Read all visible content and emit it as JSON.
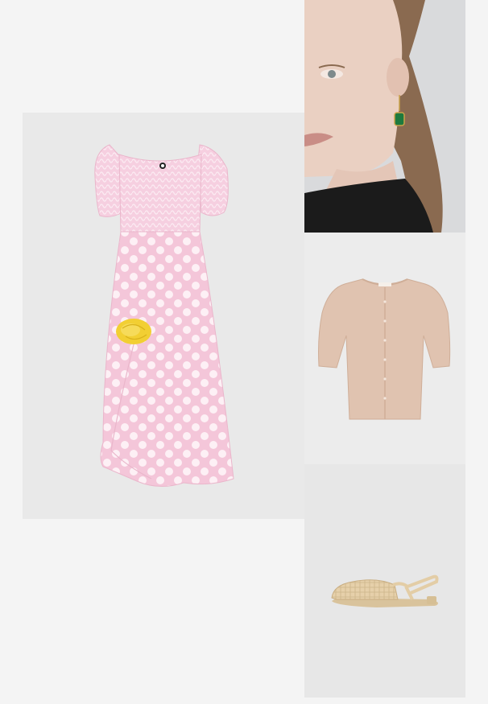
{
  "products": [
    {
      "id": "dress",
      "icon": "polka-dot-dress-image",
      "colors": {
        "fabric": "#f5c9dc",
        "dots": "#fdf1f6",
        "flower": "#f3d23a"
      }
    },
    {
      "id": "portrait",
      "icon": "model-earring-portrait-image",
      "colors": {
        "gem": "#1d7a3e",
        "top": "#1a1a1a"
      }
    },
    {
      "id": "cardigan",
      "icon": "beige-cardigan-image",
      "colors": {
        "knit": "#e0c4b2"
      }
    },
    {
      "id": "shoe",
      "icon": "woven-slingback-flat-image",
      "colors": {
        "straw": "#e3cda6"
      }
    }
  ]
}
